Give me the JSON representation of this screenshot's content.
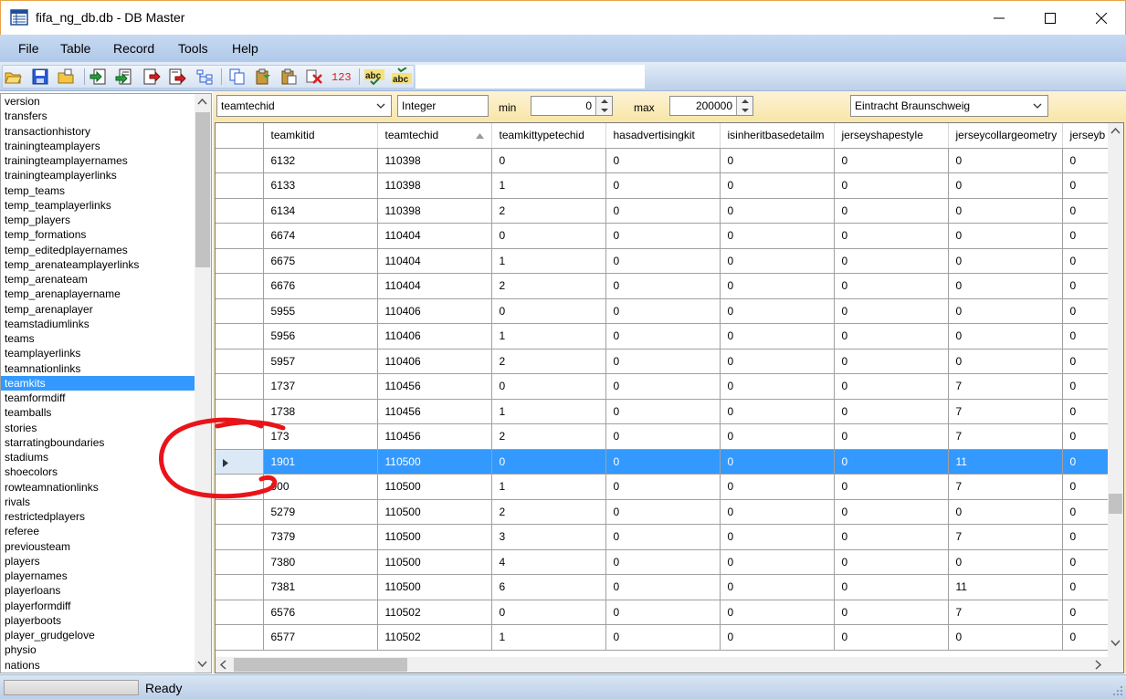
{
  "window": {
    "title": "fifa_ng_db.db - DB Master",
    "controls": [
      "minimize",
      "maximize",
      "close"
    ]
  },
  "menubar": [
    "File",
    "Table",
    "Record",
    "Tools",
    "Help"
  ],
  "toolbar": {
    "icons": [
      "open-folder-icon",
      "save-icon",
      "open-file-icon",
      "import-green-icon",
      "import-list-green-icon",
      "export-red-icon",
      "export-list-red-icon",
      "tree-icon",
      "copy-icon",
      "paste-special-icon",
      "paste-icon",
      "delete-icon",
      "numeric-icon",
      "spellcheck-icon",
      "spellcheck-alt-icon"
    ],
    "numeric_glyph": "123",
    "spell_glyph": "abc"
  },
  "tables": [
    "version",
    "transfers",
    "transactionhistory",
    "trainingteamplayers",
    "trainingteamplayernames",
    "trainingteamplayerlinks",
    "temp_teams",
    "temp_teamplayerlinks",
    "temp_players",
    "temp_formations",
    "temp_editedplayernames",
    "temp_arenateamplayerlinks",
    "temp_arenateam",
    "temp_arenaplayername",
    "temp_arenaplayer",
    "teamstadiumlinks",
    "teams",
    "teamplayerlinks",
    "teamnationlinks",
    "teamkits",
    "teamformdiff",
    "teamballs",
    "stories",
    "starratingboundaries",
    "stadiums",
    "shoecolors",
    "rowteamnationlinks",
    "rivals",
    "restrictedplayers",
    "referee",
    "previousteam",
    "players",
    "playernames",
    "playerloans",
    "playerformdiff",
    "playerboots",
    "player_grudgelove",
    "physio",
    "nations"
  ],
  "selected_table": "teamkits",
  "field_bar": {
    "field": "teamtechid",
    "type": "Integer",
    "min_label": "min",
    "min_value": "0",
    "max_label": "max",
    "max_value": "200000",
    "team": "Eintracht Braunschweig"
  },
  "grid": {
    "columns": [
      "teamkitid",
      "teamtechid",
      "teamkittypetechid",
      "hasadvertisingkit",
      "isinheritbasedetailm",
      "jerseyshapestyle",
      "jerseycollargeometry",
      "jerseyb"
    ],
    "sorted_column": "teamtechid",
    "rows": [
      [
        "6132",
        "110398",
        "0",
        "0",
        "0",
        "0",
        "0",
        "0"
      ],
      [
        "6133",
        "110398",
        "1",
        "0",
        "0",
        "0",
        "0",
        "0"
      ],
      [
        "6134",
        "110398",
        "2",
        "0",
        "0",
        "0",
        "0",
        "0"
      ],
      [
        "6674",
        "110404",
        "0",
        "0",
        "0",
        "0",
        "0",
        "0"
      ],
      [
        "6675",
        "110404",
        "1",
        "0",
        "0",
        "0",
        "0",
        "0"
      ],
      [
        "6676",
        "110404",
        "2",
        "0",
        "0",
        "0",
        "0",
        "0"
      ],
      [
        "5955",
        "110406",
        "0",
        "0",
        "0",
        "0",
        "0",
        "0"
      ],
      [
        "5956",
        "110406",
        "1",
        "0",
        "0",
        "0",
        "0",
        "0"
      ],
      [
        "5957",
        "110406",
        "2",
        "0",
        "0",
        "0",
        "0",
        "0"
      ],
      [
        "1737",
        "110456",
        "0",
        "0",
        "0",
        "0",
        "7",
        "0"
      ],
      [
        "1738",
        "110456",
        "1",
        "0",
        "0",
        "0",
        "7",
        "0"
      ],
      [
        "173",
        "110456",
        "2",
        "0",
        "0",
        "0",
        "7",
        "0"
      ],
      [
        "1901",
        "110500",
        "0",
        "0",
        "0",
        "0",
        "11",
        "0"
      ],
      [
        "900",
        "110500",
        "1",
        "0",
        "0",
        "0",
        "7",
        "0"
      ],
      [
        "5279",
        "110500",
        "2",
        "0",
        "0",
        "0",
        "0",
        "0"
      ],
      [
        "7379",
        "110500",
        "3",
        "0",
        "0",
        "0",
        "7",
        "0"
      ],
      [
        "7380",
        "110500",
        "4",
        "0",
        "0",
        "0",
        "0",
        "0"
      ],
      [
        "7381",
        "110500",
        "6",
        "0",
        "0",
        "0",
        "11",
        "0"
      ],
      [
        "6576",
        "110502",
        "0",
        "0",
        "0",
        "0",
        "7",
        "0"
      ],
      [
        "6577",
        "110502",
        "1",
        "0",
        "0",
        "0",
        "0",
        "0"
      ]
    ],
    "selected_row": 12
  },
  "status": {
    "text": "Ready"
  },
  "colors": {
    "selection": "#3399ff",
    "annotation": "#e8141a",
    "field_bar": "#f8e6a8"
  }
}
